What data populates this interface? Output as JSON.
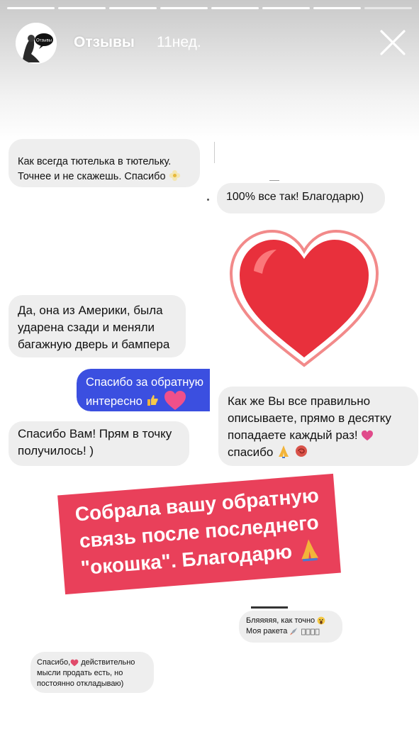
{
  "header": {
    "username": "Отзывы",
    "time": "11нед.",
    "progress_total": 8,
    "progress_done": 7,
    "avatar_text": "Отзывы"
  },
  "messages": {
    "m1": {
      "lines": [
        "Как всегда тютелька в тютельку.",
        "Точнее и не скажешь. Спасибо"
      ],
      "emoji": "flower-icon"
    },
    "m2": {
      "text": "100% все так! Благодарю)"
    },
    "m3": {
      "lines": [
        "Да, она из Америки, была",
        "ударена сзади и меняли",
        "багажную дверь и бампера"
      ]
    },
    "m4": {
      "lines": [
        "Спасибо за обратную",
        "интересно"
      ],
      "emoji": [
        "thumbs-up-icon",
        "heart-icon"
      ]
    },
    "m5": {
      "lines": [
        "Как же Вы все правильно",
        "описываете, прямо в десятку",
        "попадаете каждый раз!",
        "спасибо"
      ],
      "emoji": [
        "heart-icon",
        "pray-icon",
        "rose-icon"
      ]
    },
    "m6": {
      "lines": [
        "Спасибо Вам! Прям в точку",
        "получилось! )"
      ]
    },
    "m7": {
      "lines": [
        "Бляяяяя, как точно",
        "Моя ракета"
      ],
      "emoji": [
        "scream-icon",
        "rocket-icon"
      ]
    },
    "m8": {
      "lines": [
        "Спасибо,",
        "действительно",
        "мысли продать есть, но",
        "постоянно откладываю)"
      ]
    }
  },
  "banner": {
    "lines": [
      "Собрала вашу обратную",
      "связь после последнего",
      "\"окошка\". Благодарю"
    ],
    "background": "#e9405a",
    "emoji": "pray-icon"
  },
  "colors": {
    "blue_bubble": "#3b4fe0",
    "gray_bubble": "#eeeeee",
    "heart": "#e8303c"
  }
}
